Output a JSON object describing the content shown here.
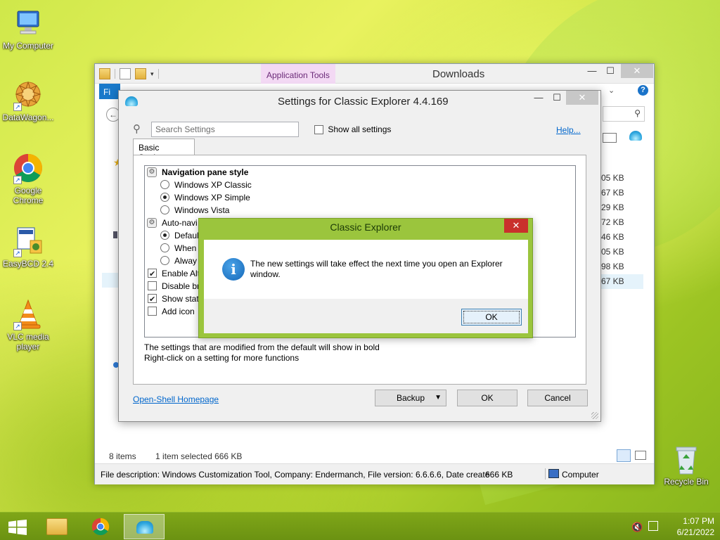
{
  "desktop": {
    "icons": [
      {
        "label": "My Computer",
        "icon": "computer-icon"
      },
      {
        "label": "DataWagon...",
        "icon": "datawagon-icon"
      },
      {
        "label": "Google Chrome",
        "icon": "chrome-icon"
      },
      {
        "label": "EasyBCD 2.4",
        "icon": "easybcd-icon"
      },
      {
        "label": "VLC media player",
        "icon": "vlc-icon"
      },
      {
        "label": "Recycle Bin",
        "icon": "recycle-bin-icon"
      }
    ]
  },
  "explorer": {
    "title": "Downloads",
    "app_tools": "Application Tools",
    "file_tab": "Fi",
    "sizes": [
      "05 KB",
      "67 KB",
      "29 KB",
      "72 KB",
      "46 KB",
      "05 KB",
      "98 KB",
      "67 KB"
    ],
    "status": {
      "items": "8 items",
      "selected": "1 item selected  666 KB"
    },
    "details_bar": {
      "description": "File description: Windows Customization Tool, Company: Endermanch, File version: 6.6.6.6, Date create",
      "size": "666 KB",
      "location": "Computer"
    }
  },
  "settings": {
    "title": "Settings for Classic Explorer 4.4.169",
    "search_placeholder": "Search Settings",
    "show_all_label": "Show all settings",
    "help_label": "Help...",
    "tab_label": "Basic Settings",
    "tree": [
      {
        "type": "group",
        "label": "Navigation pane style"
      },
      {
        "type": "radio",
        "label": "Windows XP Classic",
        "checked": false
      },
      {
        "type": "radio",
        "label": "Windows XP Simple",
        "checked": true
      },
      {
        "type": "radio",
        "label": "Windows Vista",
        "checked": false
      },
      {
        "type": "group2",
        "label": "Auto-navi"
      },
      {
        "type": "radio",
        "label": "Defaul",
        "checked": true
      },
      {
        "type": "radio",
        "label": "When",
        "checked": false
      },
      {
        "type": "radio",
        "label": "Alway",
        "checked": false
      },
      {
        "type": "check",
        "label": "Enable Alt",
        "checked": true
      },
      {
        "type": "check",
        "label": "Disable br",
        "checked": false
      },
      {
        "type": "check",
        "label": "Show stat",
        "checked": true
      },
      {
        "type": "check",
        "label": "Add icon",
        "checked": false
      }
    ],
    "note_line1": "The settings that are modified from the default will show in bold",
    "note_line2": "Right-click on a setting for more functions",
    "homepage_label": "Open-Shell Homepage",
    "backup_label": "Backup",
    "ok_label": "OK",
    "cancel_label": "Cancel"
  },
  "message_box": {
    "title": "Classic Explorer",
    "text": "The new settings will take effect the next time you open an Explorer window.",
    "ok_label": "OK",
    "close_glyph": "✕"
  },
  "taskbar": {
    "time": "1:07 PM",
    "date": "6/21/2022"
  }
}
